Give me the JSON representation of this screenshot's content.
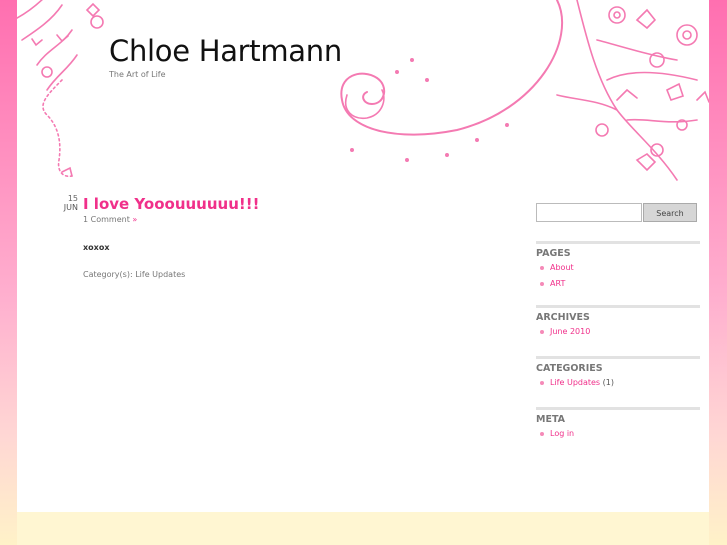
{
  "header": {
    "site_title": "Chloe Hartmann",
    "tagline": "The Art of Life"
  },
  "post": {
    "date_day": "15",
    "date_month": "JUN",
    "title": "I love Yooouuuuuu!!!",
    "comments": "1 Comment",
    "comments_suffix": "»",
    "body": "xoxox",
    "category_label": "Category(s):",
    "category_value": "Life Updates"
  },
  "sidebar": {
    "search_value": "",
    "search_button": "Search",
    "pages": {
      "title": "PAGES",
      "items": [
        "About",
        "ART"
      ]
    },
    "archives": {
      "title": "ARCHIVES",
      "items": [
        "June 2010"
      ]
    },
    "categories": {
      "title": "CATEGORIES",
      "items": [
        {
          "label": "Life Updates",
          "count": "(1)"
        }
      ]
    },
    "meta": {
      "title": "META",
      "items": [
        "Log in"
      ]
    }
  },
  "colors": {
    "accent_pink": "#f0308a",
    "decor_pink": "#f47ab2",
    "background_top": "#ff6fb0",
    "background_bottom": "#fff2c8"
  }
}
